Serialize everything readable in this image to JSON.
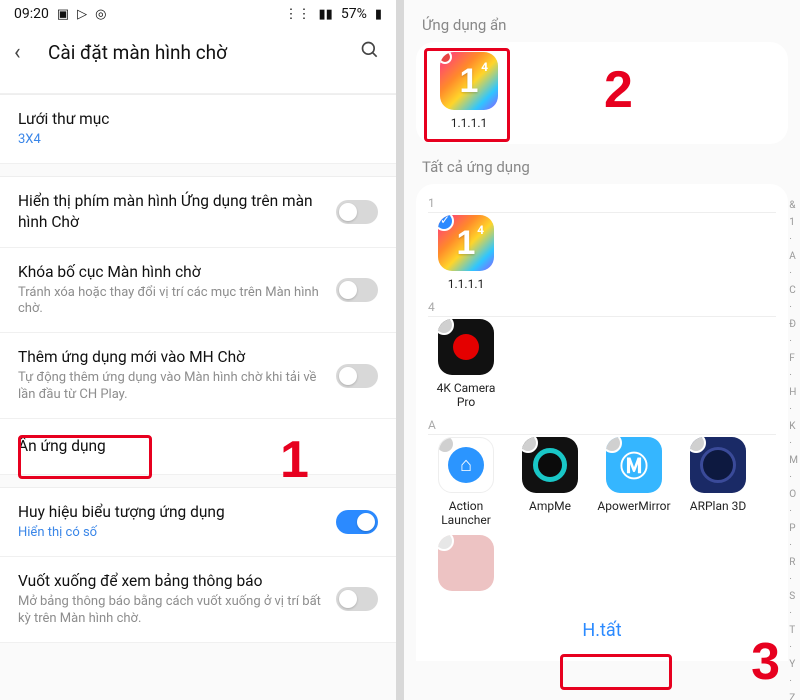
{
  "left": {
    "status": {
      "time": "09:20",
      "battery": "57%"
    },
    "header_title": "Cài đặt màn hình chờ",
    "rows": {
      "grid": {
        "label": "Lưới thư mục",
        "sub": "3X4"
      },
      "appsBtn": {
        "label": "Hiển thị phím màn hình Ứng dụng trên màn hình Chờ"
      },
      "lock": {
        "label": "Khóa bố cục Màn hình chờ",
        "sub": "Tránh xóa hoặc thay đổi vị trí các mục trên Màn hình chờ."
      },
      "addNew": {
        "label": "Thêm ứng dụng mới vào MH Chờ",
        "sub": "Tự động thêm ứng dụng vào Màn hình chờ khi tải về lần đầu từ CH Play."
      },
      "hide": {
        "label": "Ẩn ứng dụng"
      },
      "badge": {
        "label": "Huy hiệu biểu tượng ứng dụng",
        "sub": "Hiển thị có số"
      },
      "swipe": {
        "label": "Vuốt xuống để xem bảng thông báo",
        "sub": "Mở bảng thông báo bằng cách vuốt xuống ở vị trí bất kỳ trên Màn hình chờ."
      }
    },
    "annot1": "1"
  },
  "right": {
    "hidden_label": "Ứng dụng ẩn",
    "all_label": "Tất cả ứng dụng",
    "hidden_app": {
      "name": "1.1.1.1"
    },
    "sections": {
      "s1": {
        "hdr": "1",
        "apps": [
          {
            "name": "1.1.1.1"
          }
        ]
      },
      "s4": {
        "hdr": "4",
        "apps": [
          {
            "name": "4K Camera Pro"
          }
        ]
      },
      "sA": {
        "hdr": "A",
        "apps": [
          {
            "name": "Action Launcher"
          },
          {
            "name": "AmpMe"
          },
          {
            "name": "ApowerMirror"
          },
          {
            "name": "ARPlan 3D"
          }
        ]
      }
    },
    "index": [
      "&",
      "1",
      "·",
      "A",
      "·",
      "C",
      "·",
      "Đ",
      "·",
      "F",
      "·",
      "H",
      "·",
      "K",
      "·",
      "M",
      "·",
      "O",
      "·",
      "P",
      "·",
      "R",
      "·",
      "S",
      "·",
      "T",
      "·",
      "Y",
      "·",
      "Z"
    ],
    "done_label": "H.tất",
    "annot2": "2",
    "annot3": "3"
  }
}
